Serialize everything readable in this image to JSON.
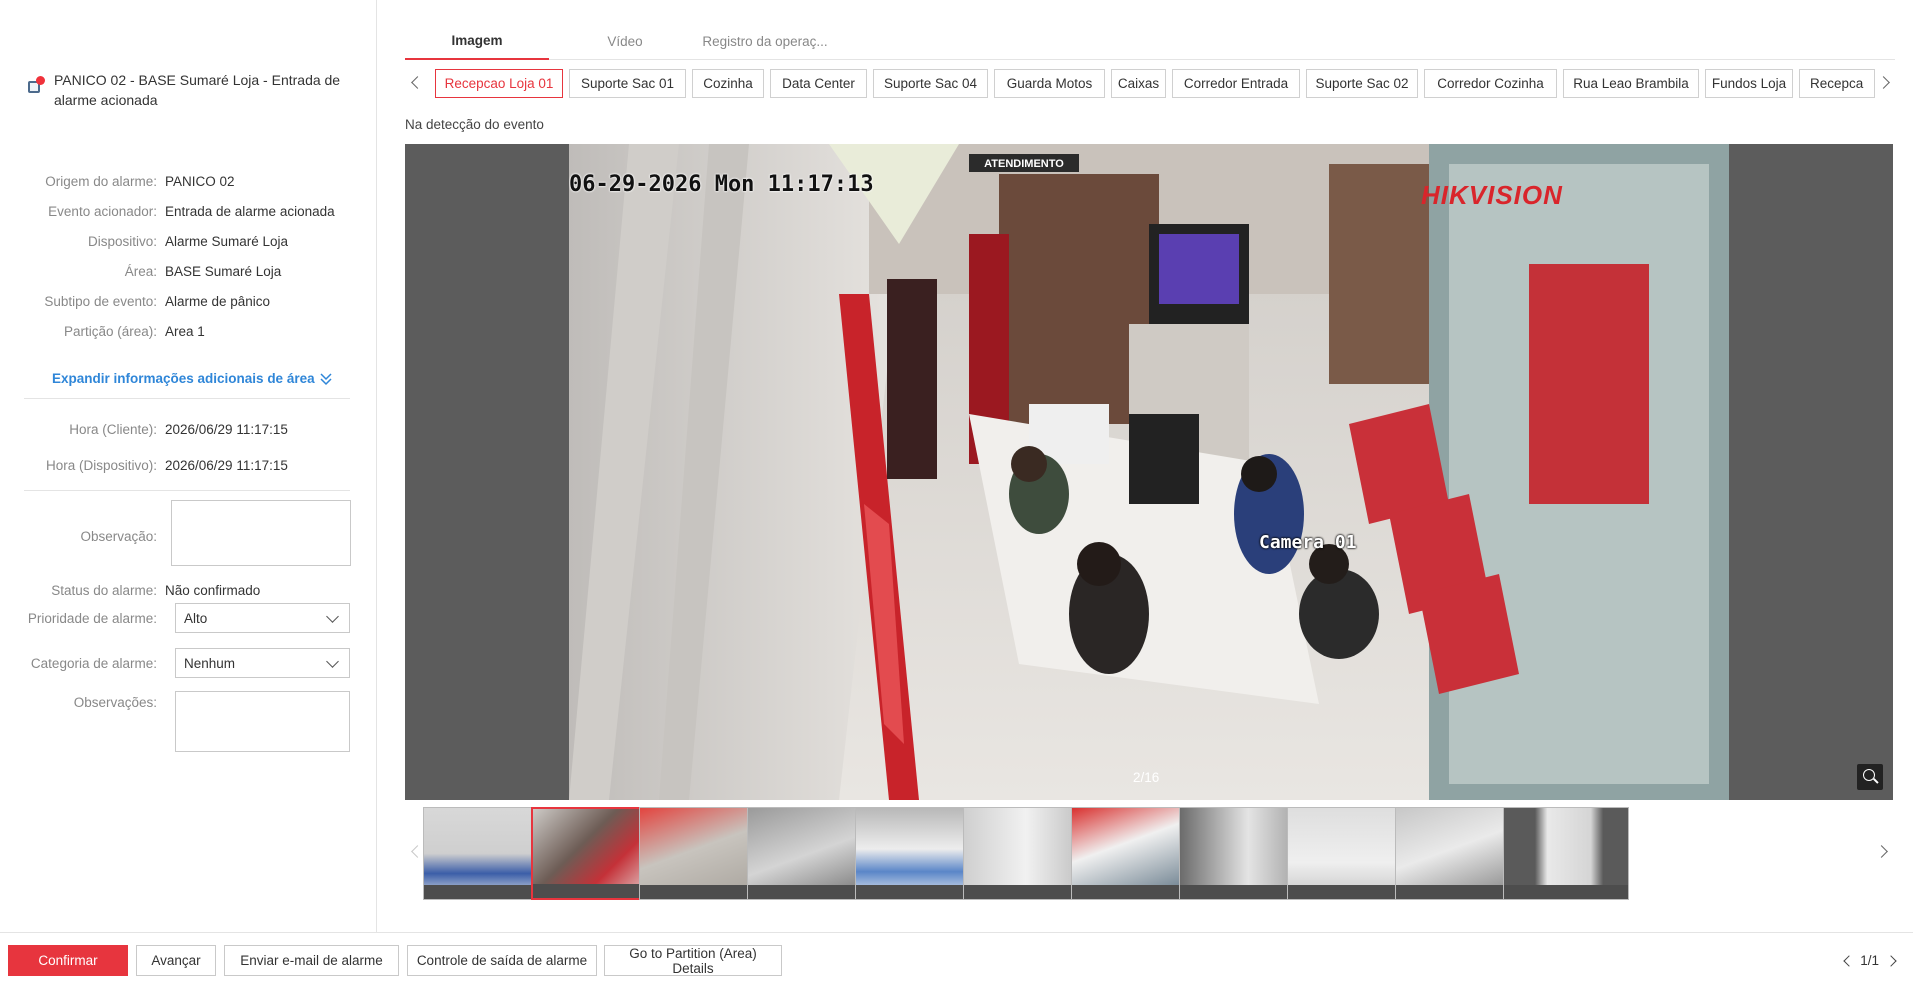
{
  "alarm": {
    "title": "PANICO 02 - BASE Sumaré Loja - Entrada de alarme acionada",
    "details": [
      {
        "label": "Origem do alarme:",
        "value": "PANICO 02"
      },
      {
        "label": "Evento acionador:",
        "value": "Entrada de alarme acionada"
      },
      {
        "label": "Dispositivo:",
        "value": "Alarme Sumaré Loja"
      },
      {
        "label": "Área:",
        "value": "BASE Sumaré Loja"
      },
      {
        "label": "Subtipo de evento:",
        "value": "Alarme de pânico"
      },
      {
        "label": "Partição (área):",
        "value": "Area 1"
      }
    ],
    "expand_label": "Expandir informações adicionais de área",
    "times": [
      {
        "label": "Hora (Cliente):",
        "value": "2026/06/29 11:17:15"
      },
      {
        "label": "Hora (Dispositivo):",
        "value": "2026/06/29 11:17:15"
      }
    ],
    "observacao_label": "Observação:",
    "status_label": "Status do alarme:",
    "status_value": "Não confirmado",
    "priority_label": "Prioridade de alarme:",
    "priority_value": "Alto",
    "category_label": "Categoria de alarme:",
    "category_value": "Nenhum",
    "observacoes_label": "Observações:"
  },
  "tabs": [
    {
      "label": "Imagem",
      "active": true
    },
    {
      "label": "Vídeo",
      "active": false
    },
    {
      "label": "Registro da operaç...",
      "active": false
    }
  ],
  "cameras": [
    "Recepcao Loja 01",
    "Suporte Sac 01",
    "Cozinha",
    "Data Center",
    "Suporte Sac 04",
    "Guarda Motos",
    "Caixas",
    "Corredor Entrada",
    "Suporte Sac 02",
    "Corredor Cozinha",
    "Rua Leao Brambila",
    "Fundos Loja",
    "Recepca"
  ],
  "active_camera": "Recepcao Loja 01",
  "viewer": {
    "section_label": "Na detecção do evento",
    "osd_timestamp": "06-29-2026 Mon 11:17:13",
    "osd_brand": "HIKVISION",
    "osd_camera": "Camera 01",
    "osd_sign": "ATENDIMENTO",
    "counter": "2/16"
  },
  "footer": {
    "confirm": "Confirmar",
    "next": "Avançar",
    "email": "Enviar e-mail de alarme",
    "exit_control": "Controle de saída de alarme",
    "partition_details": "Go to Partition (Area) Details",
    "page": "1/1"
  },
  "colors": {
    "accent": "#e7353e",
    "link": "#2f86d8"
  }
}
